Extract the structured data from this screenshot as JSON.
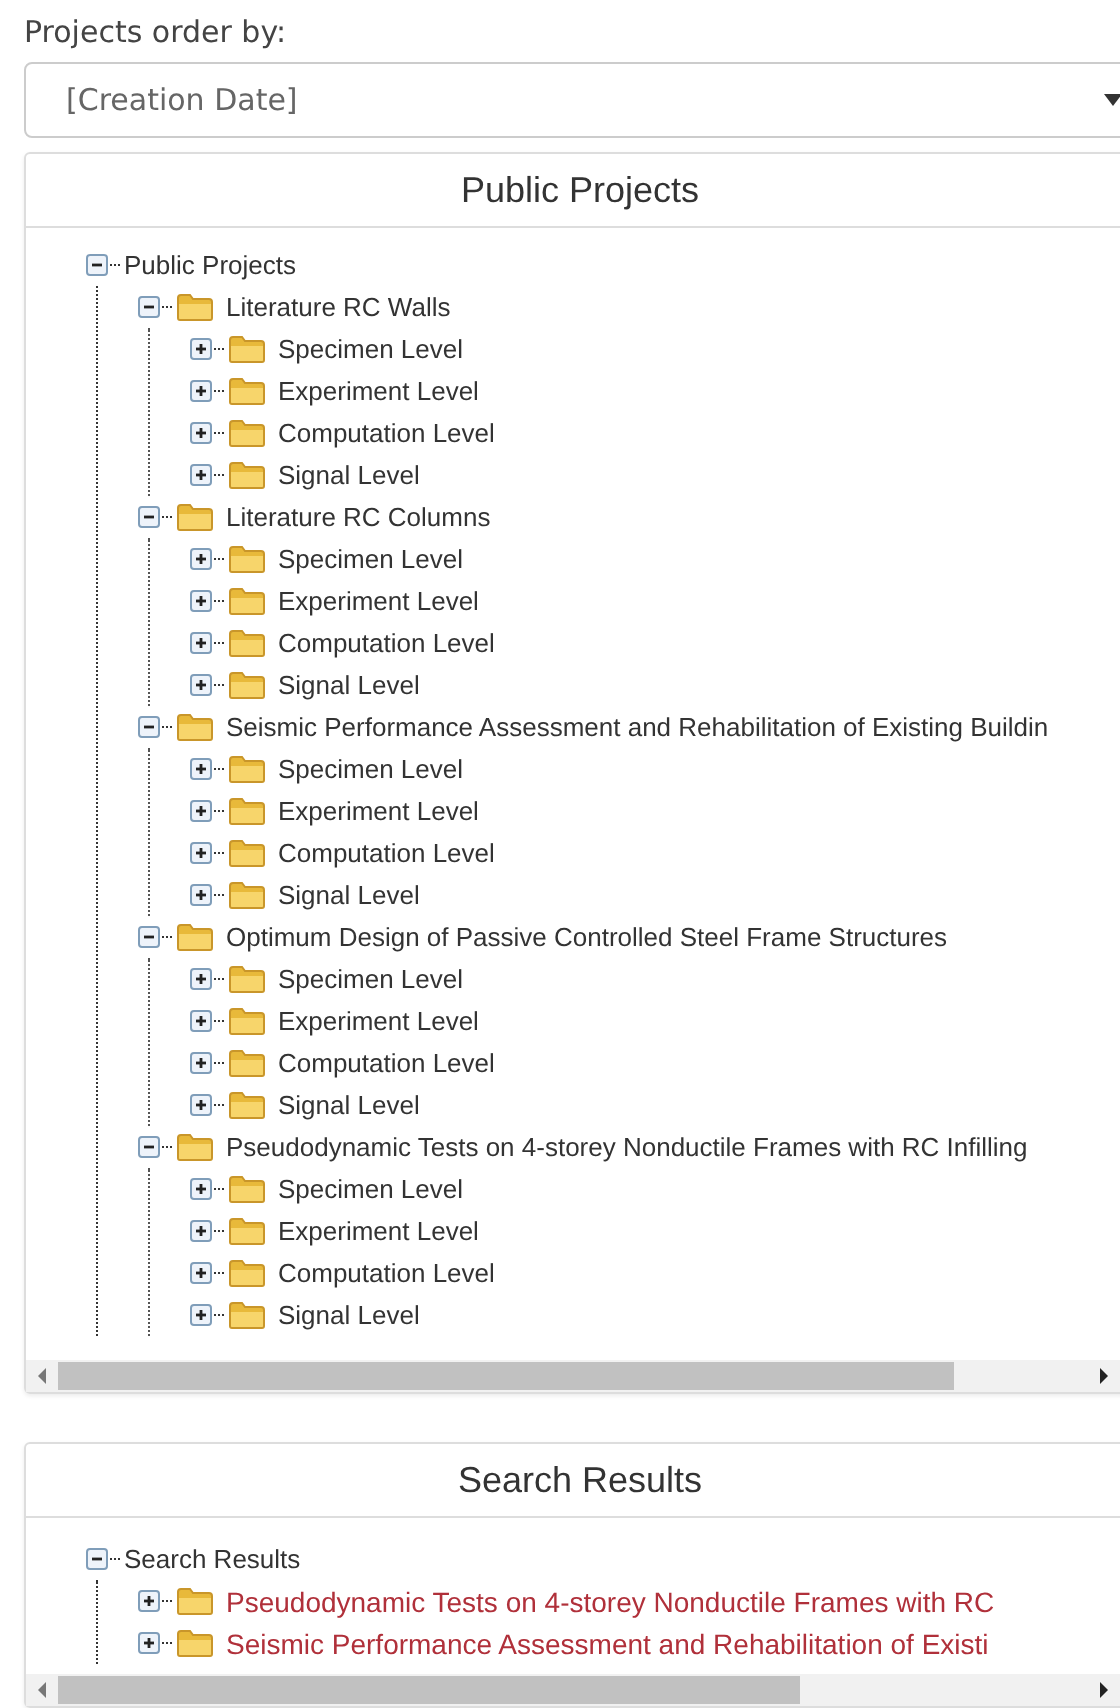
{
  "order_label": "Projects order by:",
  "order_select": {
    "value": "[Creation Date]"
  },
  "public_panel": {
    "title": "Public Projects",
    "tree": {
      "label": "Public Projects",
      "expanded": true,
      "children": [
        {
          "label": "Literature RC Walls",
          "expanded": true,
          "children": [
            {
              "label": "Specimen Level",
              "expanded": false
            },
            {
              "label": "Experiment Level",
              "expanded": false
            },
            {
              "label": "Computation Level",
              "expanded": false
            },
            {
              "label": "Signal Level",
              "expanded": false
            }
          ]
        },
        {
          "label": "Literature RC Columns",
          "expanded": true,
          "children": [
            {
              "label": "Specimen Level",
              "expanded": false
            },
            {
              "label": "Experiment Level",
              "expanded": false
            },
            {
              "label": "Computation Level",
              "expanded": false
            },
            {
              "label": "Signal Level",
              "expanded": false
            }
          ]
        },
        {
          "label": "Seismic Performance Assessment and Rehabilitation of Existing Buildin",
          "expanded": true,
          "children": [
            {
              "label": "Specimen Level",
              "expanded": false
            },
            {
              "label": "Experiment Level",
              "expanded": false
            },
            {
              "label": "Computation Level",
              "expanded": false
            },
            {
              "label": "Signal Level",
              "expanded": false
            }
          ]
        },
        {
          "label": "Optimum Design of Passive Controlled Steel Frame Structures",
          "expanded": true,
          "children": [
            {
              "label": "Specimen Level",
              "expanded": false
            },
            {
              "label": "Experiment Level",
              "expanded": false
            },
            {
              "label": "Computation Level",
              "expanded": false
            },
            {
              "label": "Signal Level",
              "expanded": false
            }
          ]
        },
        {
          "label": "Pseudodynamic Tests on 4-storey Nonductile Frames with RC Infilling",
          "expanded": true,
          "children": [
            {
              "label": "Specimen Level",
              "expanded": false
            },
            {
              "label": "Experiment Level",
              "expanded": false
            },
            {
              "label": "Computation Level",
              "expanded": false
            },
            {
              "label": "Signal Level",
              "expanded": false
            }
          ]
        }
      ]
    }
  },
  "search_panel": {
    "title": "Search Results",
    "tree": {
      "label": "Search Results",
      "expanded": true,
      "children": [
        {
          "label": "Pseudodynamic Tests on 4-storey Nonductile Frames with RC",
          "expanded": false
        },
        {
          "label": "Seismic Performance Assessment and Rehabilitation of Existi",
          "expanded": false
        }
      ]
    }
  }
}
